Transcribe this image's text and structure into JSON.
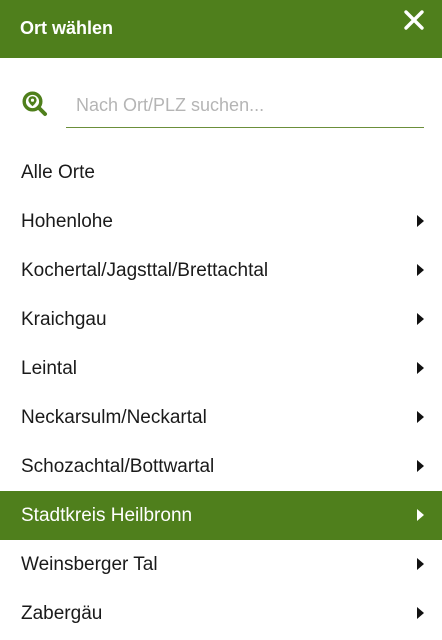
{
  "header": {
    "title": "Ort wählen",
    "close_icon": "close-icon",
    "background": "#4f7f1c"
  },
  "search": {
    "icon": "search-location-icon",
    "placeholder": "Nach Ort/PLZ suchen...",
    "value": ""
  },
  "places": [
    {
      "label": "Alle Orte",
      "has_submenu": false,
      "active": false
    },
    {
      "label": "Hohenlohe",
      "has_submenu": true,
      "active": false
    },
    {
      "label": "Kochertal/Jagsttal/Brettachtal",
      "has_submenu": true,
      "active": false
    },
    {
      "label": "Kraichgau",
      "has_submenu": true,
      "active": false
    },
    {
      "label": "Leintal",
      "has_submenu": true,
      "active": false
    },
    {
      "label": "Neckarsulm/Neckartal",
      "has_submenu": true,
      "active": false
    },
    {
      "label": "Schozachtal/Bottwartal",
      "has_submenu": true,
      "active": false
    },
    {
      "label": "Stadtkreis Heilbronn",
      "has_submenu": true,
      "active": true
    },
    {
      "label": "Weinsberger Tal",
      "has_submenu": true,
      "active": false
    },
    {
      "label": "Zabergäu",
      "has_submenu": true,
      "active": false
    }
  ],
  "colors": {
    "accent": "#4f7f1c",
    "text": "#1a1a1a",
    "placeholder": "#b5b5b5"
  }
}
